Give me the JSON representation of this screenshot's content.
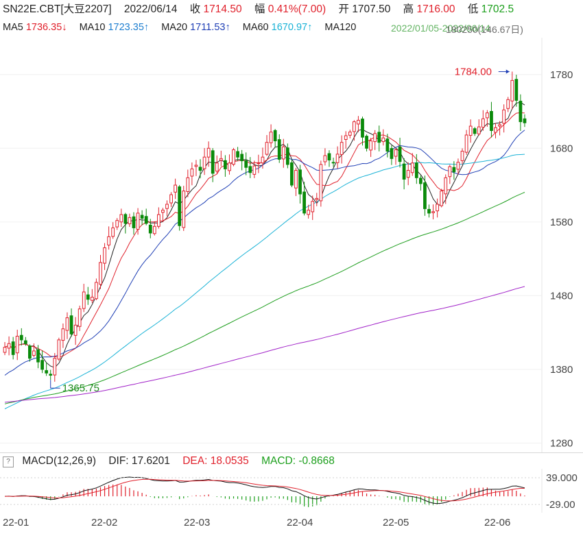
{
  "header": {
    "symbol": "SN22E.CBT[大豆2207]",
    "date": "2022/06/14",
    "close_label": "收",
    "close_value": "1714.50",
    "change_label": "幅",
    "change_value": "0.41%(7.00)",
    "open_label": "开",
    "open_value": "1707.50",
    "high_label": "高",
    "high_value": "1716.00",
    "low_label": "低",
    "low_value": "1702.5"
  },
  "ma_legend": {
    "ma5": "MA5",
    "ma5_value": "1736.35↓",
    "ma10": "MA10",
    "ma10_value": "1723.35↑",
    "ma20": "MA20",
    "ma20_value": "1711.53↑",
    "ma60": "MA60",
    "ma60_value": "1670.97↑",
    "ma120": "MA120",
    "overlay_text": "2022/01/05-2022/06/14",
    "overlay_text2": "180250(146.67日)"
  },
  "macd_legend": {
    "collapse": "?",
    "name": "MACD(12,26,9)",
    "dif": "DIF: 17.6201",
    "dea": "DEA: 18.0535",
    "macd": "MACD: -0.8668"
  },
  "chart_data": [
    {
      "type": "candlestick",
      "y_ticks": [
        1780,
        1680,
        1580,
        1480,
        1380,
        1280
      ],
      "ylim": [
        1272,
        1830
      ],
      "x_ticks": [
        "22-01",
        "22-02",
        "22-03",
        "22-04",
        "22-05",
        "22-06"
      ],
      "annotations": {
        "max_label": "1784.00",
        "min_label": "1365.75"
      },
      "colors": {
        "up": "#e0202b",
        "down": "#0a8a0a",
        "ma5": "#222222",
        "ma10": "#e0202b",
        "ma20": "#1f3fb5",
        "ma60": "#19b2d6",
        "ma120": "#1e9e1e",
        "ma250": "#a020c8"
      },
      "closes": [
        1410,
        1415,
        1400,
        1425,
        1420,
        1415,
        1395,
        1405,
        1390,
        1380,
        1375,
        1372,
        1395,
        1420,
        1435,
        1450,
        1428,
        1440,
        1462,
        1485,
        1475,
        1478,
        1498,
        1525,
        1545,
        1560,
        1572,
        1582,
        1590,
        1578,
        1586,
        1572,
        1592,
        1585,
        1578,
        1565,
        1574,
        1590,
        1596,
        1604,
        1617,
        1630,
        1575,
        1622,
        1640,
        1652,
        1657,
        1650,
        1668,
        1680,
        1646,
        1660,
        1666,
        1652,
        1660,
        1678,
        1668,
        1663,
        1654,
        1647,
        1656,
        1660,
        1668,
        1688,
        1702,
        1690,
        1665,
        1682,
        1658,
        1630,
        1650,
        1618,
        1592,
        1596,
        1608,
        1612,
        1658,
        1670,
        1664,
        1660,
        1672,
        1688,
        1697,
        1702,
        1716,
        1718,
        1695,
        1680,
        1690,
        1700,
        1688,
        1694,
        1676,
        1666,
        1678,
        1662,
        1638,
        1650,
        1660,
        1640,
        1632,
        1598,
        1592,
        1594,
        1604,
        1622,
        1640,
        1655,
        1648,
        1661,
        1676,
        1698,
        1710,
        1700,
        1709,
        1720,
        1728,
        1704,
        1708,
        1712,
        1732,
        1746,
        1772,
        1745,
        1716,
        1714.5
      ]
    },
    {
      "type": "line",
      "series": [
        {
          "name": "DIF",
          "values": "derived from closes (EMA12-EMA26)"
        },
        {
          "name": "DEA",
          "values": "EMA9 of DIF"
        }
      ],
      "y_ticks": [
        "39.000",
        "-29.00"
      ]
    }
  ]
}
